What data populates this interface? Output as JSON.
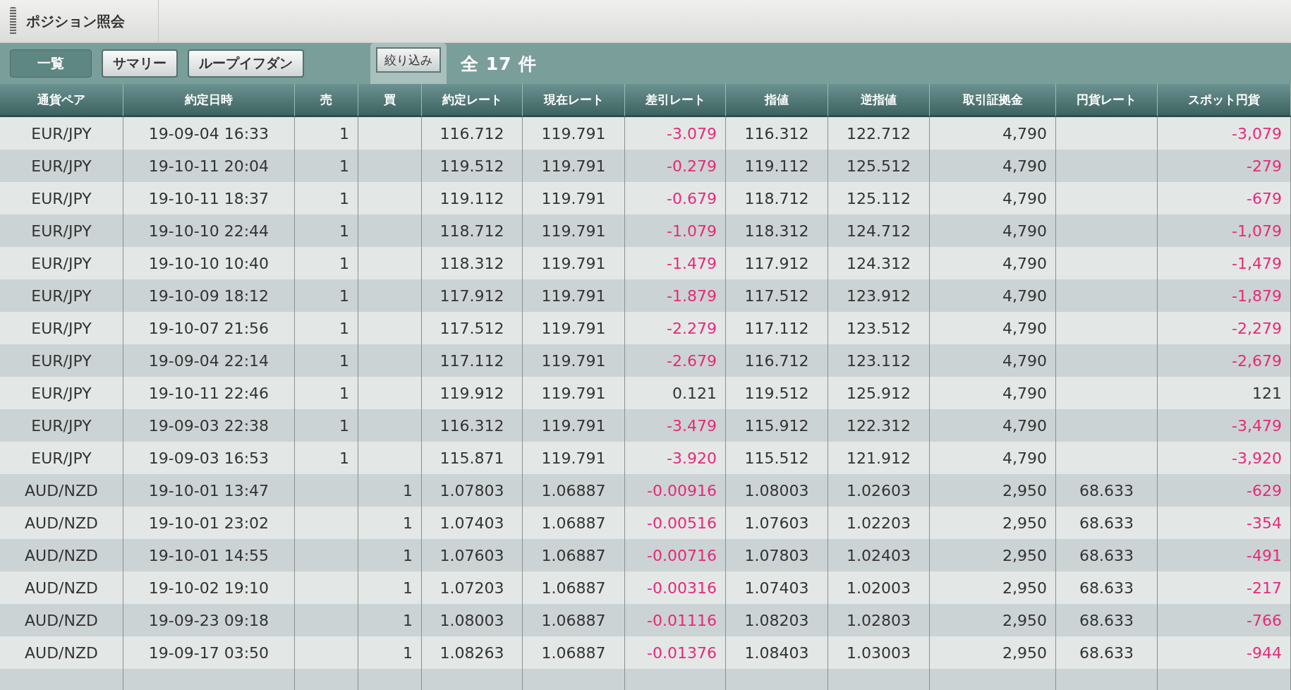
{
  "title": "ポジション照会",
  "tabs": [
    {
      "label": "一覧",
      "selected": true
    },
    {
      "label": "サマリー",
      "selected": false
    },
    {
      "label": "ループイフダン",
      "selected": false
    }
  ],
  "filter_button": "絞り込み",
  "count": "全 17 件",
  "columns": [
    "通貨ペア",
    "約定日時",
    "売",
    "買",
    "約定レート",
    "現在レート",
    "差引レート",
    "指値",
    "逆指値",
    "取引証拠金",
    "円貨レート",
    "スポット円貨"
  ],
  "rows": [
    {
      "cells": [
        "EUR/JPY",
        "19-09-04 16:33",
        "1",
        "",
        "116.712",
        "119.791",
        "-3.079",
        "116.312",
        "122.712",
        "4,790",
        "",
        "-3,079"
      ],
      "loss": true
    },
    {
      "cells": [
        "EUR/JPY",
        "19-10-11 20:04",
        "1",
        "",
        "119.512",
        "119.791",
        "-0.279",
        "119.112",
        "125.512",
        "4,790",
        "",
        "-279"
      ],
      "loss": true
    },
    {
      "cells": [
        "EUR/JPY",
        "19-10-11 18:37",
        "1",
        "",
        "119.112",
        "119.791",
        "-0.679",
        "118.712",
        "125.112",
        "4,790",
        "",
        "-679"
      ],
      "loss": true
    },
    {
      "cells": [
        "EUR/JPY",
        "19-10-10 22:44",
        "1",
        "",
        "118.712",
        "119.791",
        "-1.079",
        "118.312",
        "124.712",
        "4,790",
        "",
        "-1,079"
      ],
      "loss": true
    },
    {
      "cells": [
        "EUR/JPY",
        "19-10-10 10:40",
        "1",
        "",
        "118.312",
        "119.791",
        "-1.479",
        "117.912",
        "124.312",
        "4,790",
        "",
        "-1,479"
      ],
      "loss": true
    },
    {
      "cells": [
        "EUR/JPY",
        "19-10-09 18:12",
        "1",
        "",
        "117.912",
        "119.791",
        "-1.879",
        "117.512",
        "123.912",
        "4,790",
        "",
        "-1,879"
      ],
      "loss": true
    },
    {
      "cells": [
        "EUR/JPY",
        "19-10-07 21:56",
        "1",
        "",
        "117.512",
        "119.791",
        "-2.279",
        "117.112",
        "123.512",
        "4,790",
        "",
        "-2,279"
      ],
      "loss": true
    },
    {
      "cells": [
        "EUR/JPY",
        "19-09-04 22:14",
        "1",
        "",
        "117.112",
        "119.791",
        "-2.679",
        "116.712",
        "123.112",
        "4,790",
        "",
        "-2,679"
      ],
      "loss": true
    },
    {
      "cells": [
        "EUR/JPY",
        "19-10-11 22:46",
        "1",
        "",
        "119.912",
        "119.791",
        "0.121",
        "119.512",
        "125.912",
        "4,790",
        "",
        "121"
      ],
      "loss": false
    },
    {
      "cells": [
        "EUR/JPY",
        "19-09-03 22:38",
        "1",
        "",
        "116.312",
        "119.791",
        "-3.479",
        "115.912",
        "122.312",
        "4,790",
        "",
        "-3,479"
      ],
      "loss": true
    },
    {
      "cells": [
        "EUR/JPY",
        "19-09-03 16:53",
        "1",
        "",
        "115.871",
        "119.791",
        "-3.920",
        "115.512",
        "121.912",
        "4,790",
        "",
        "-3,920"
      ],
      "loss": true
    },
    {
      "cells": [
        "AUD/NZD",
        "19-10-01 13:47",
        "",
        "1",
        "1.07803",
        "1.06887",
        "-0.00916",
        "1.08003",
        "1.02603",
        "2,950",
        "68.633",
        "-629"
      ],
      "loss": true
    },
    {
      "cells": [
        "AUD/NZD",
        "19-10-01 23:02",
        "",
        "1",
        "1.07403",
        "1.06887",
        "-0.00516",
        "1.07603",
        "1.02203",
        "2,950",
        "68.633",
        "-354"
      ],
      "loss": true
    },
    {
      "cells": [
        "AUD/NZD",
        "19-10-01 14:55",
        "",
        "1",
        "1.07603",
        "1.06887",
        "-0.00716",
        "1.07803",
        "1.02403",
        "2,950",
        "68.633",
        "-491"
      ],
      "loss": true
    },
    {
      "cells": [
        "AUD/NZD",
        "19-10-02 19:10",
        "",
        "1",
        "1.07203",
        "1.06887",
        "-0.00316",
        "1.07403",
        "1.02003",
        "2,950",
        "68.633",
        "-217"
      ],
      "loss": true
    },
    {
      "cells": [
        "AUD/NZD",
        "19-09-23 09:18",
        "",
        "1",
        "1.08003",
        "1.06887",
        "-0.01116",
        "1.08203",
        "1.02803",
        "2,950",
        "68.633",
        "-766"
      ],
      "loss": true
    },
    {
      "cells": [
        "AUD/NZD",
        "19-09-17 03:50",
        "",
        "1",
        "1.08263",
        "1.06887",
        "-0.01376",
        "1.08403",
        "1.03003",
        "2,950",
        "68.633",
        "-944"
      ],
      "loss": true
    }
  ]
}
